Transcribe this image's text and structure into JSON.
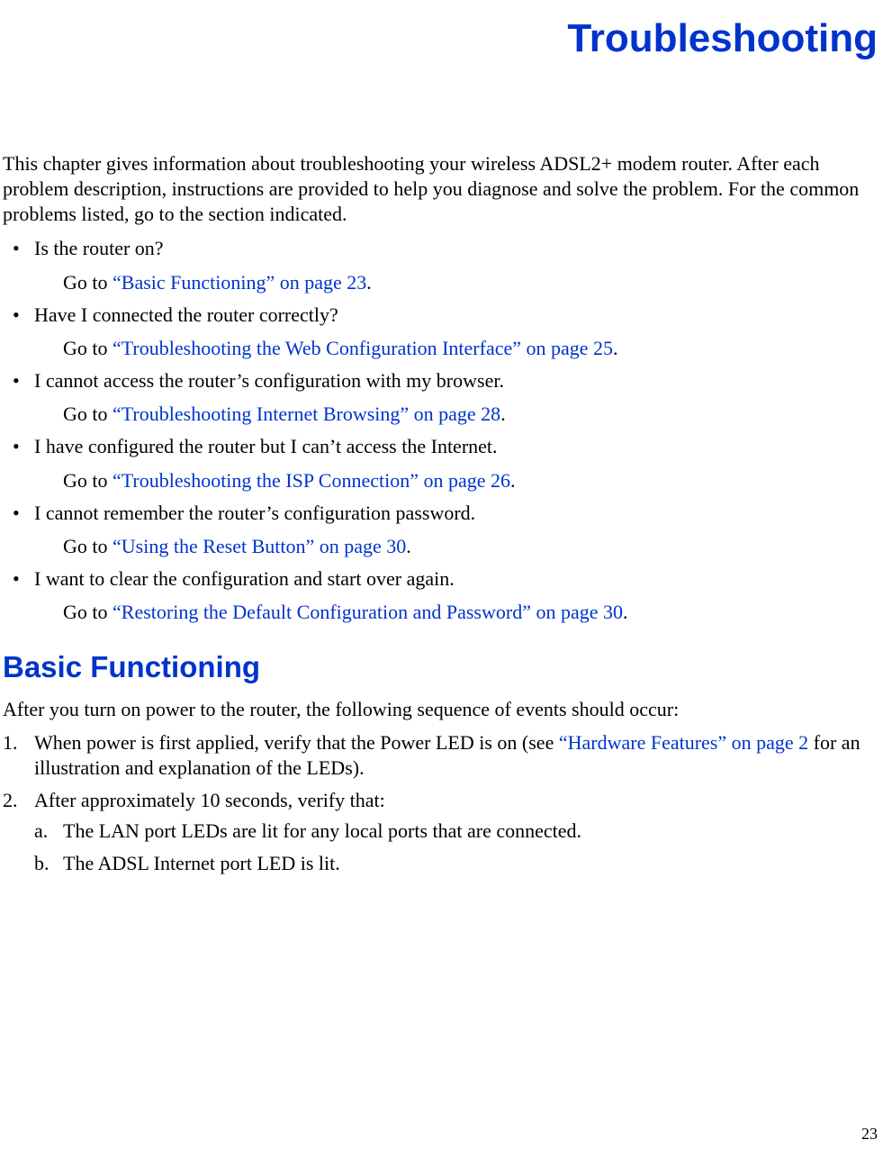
{
  "title": "Troubleshooting",
  "intro": "This chapter gives information about troubleshooting your wireless ADSL2+ modem router. After each problem description, instructions are provided to help you diagnose and solve the problem. For the common problems listed, go to the section indicated.",
  "items": [
    {
      "question": "Is the router on?",
      "goto_prefix": "Go to ",
      "link": "“Basic Functioning” on page 23",
      "suffix": "."
    },
    {
      "question": "Have I connected the router correctly?",
      "goto_prefix": "Go to ",
      "link": "“Troubleshooting the Web Configuration Interface” on page 25",
      "suffix": "."
    },
    {
      "question": "I cannot access the router’s configuration with my browser.",
      "goto_prefix": "Go to ",
      "link": "“Troubleshooting Internet Browsing” on page 28",
      "suffix": "."
    },
    {
      "question": "I have configured the router but I can’t access the Internet.",
      "goto_prefix": "Go to ",
      "link": "“Troubleshooting the ISP Connection” on page 26",
      "suffix": "."
    },
    {
      "question": "I cannot remember the router’s configuration password.",
      "goto_prefix": "Go to ",
      "link": "“Using the Reset Button” on page 30",
      "suffix": "."
    },
    {
      "question": "I want to clear the configuration and start over again.",
      "goto_prefix": "Go to ",
      "link": "“Restoring the Default Configuration and Password” on page 30",
      "suffix": "."
    }
  ],
  "heading2": "Basic Functioning",
  "after_text": "After you turn on power to the router, the following sequence of events should occur:",
  "num1_pre": "When power is first applied, verify that the Power LED is on (see ",
  "num1_link": "“Hardware Features” on page 2",
  "num1_post": " for an illustration and explanation of the LEDs).",
  "num2": "After approximately 10 seconds, verify that:",
  "num2a": "The LAN port LEDs are lit for any local ports that are connected.",
  "num2b": "The ADSL Internet port LED is lit.",
  "page_number": "23"
}
